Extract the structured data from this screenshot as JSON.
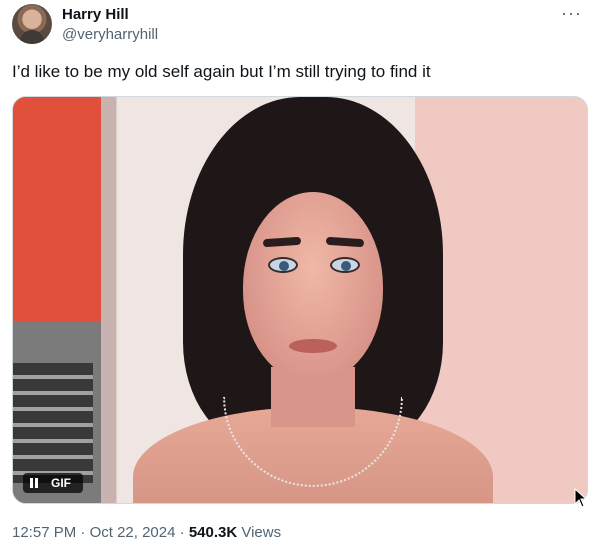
{
  "author": {
    "name": "Harry Hill",
    "handle": "@veryharryhill"
  },
  "more_icon": "more-horizontal-icon",
  "tweet_text": "I’d like to be my old self again but I’m still trying to find it",
  "media": {
    "type": "GIF",
    "badge_label": "GIF",
    "pause_icon": "pause-icon"
  },
  "meta": {
    "time": "12:57 PM",
    "separator1": " · ",
    "date": "Oct 22, 2024",
    "separator2": " · ",
    "views_count": "540.3K",
    "views_label": " Views"
  }
}
